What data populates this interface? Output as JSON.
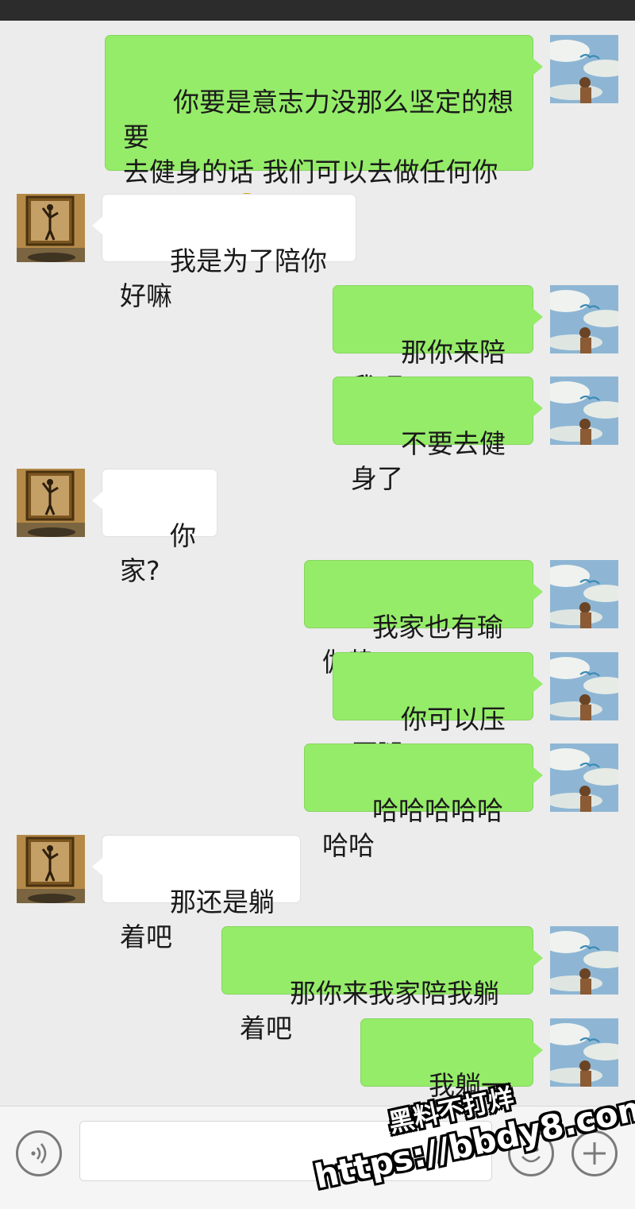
{
  "colors": {
    "chat_background": "#ececec",
    "my_bubble": "#95ec69",
    "their_bubble": "#ffffff"
  },
  "messages": [
    {
      "from": "me",
      "text": "你要是意志力没那么坚定的想要\n去健身的话 我们可以去做任何你\n想做的事",
      "emoji": "smiling-face-icon"
    },
    {
      "from": "them",
      "text": "我是为了陪你好嘛"
    },
    {
      "from": "me",
      "text": "那你来陪我吧"
    },
    {
      "from": "me",
      "text": "不要去健身了"
    },
    {
      "from": "them",
      "text": "你家?"
    },
    {
      "from": "me",
      "text": "我家也有瑜伽垫"
    },
    {
      "from": "me",
      "text": "你可以压压腿"
    },
    {
      "from": "me",
      "text": "哈哈哈哈哈哈哈"
    },
    {
      "from": "them",
      "text": "那还是躺着吧"
    },
    {
      "from": "me",
      "text": "那你来我家陪我躺着吧"
    },
    {
      "from": "me",
      "text": "我躺一天了"
    }
  ],
  "input_bar": {
    "voice_icon": "voice-icon",
    "emoji_icon": "emoji-icon",
    "plus_icon": "plus-icon",
    "input_value": ""
  },
  "watermark": {
    "line1": "黑料不打烊",
    "line2": "https://bbdy8.com"
  }
}
